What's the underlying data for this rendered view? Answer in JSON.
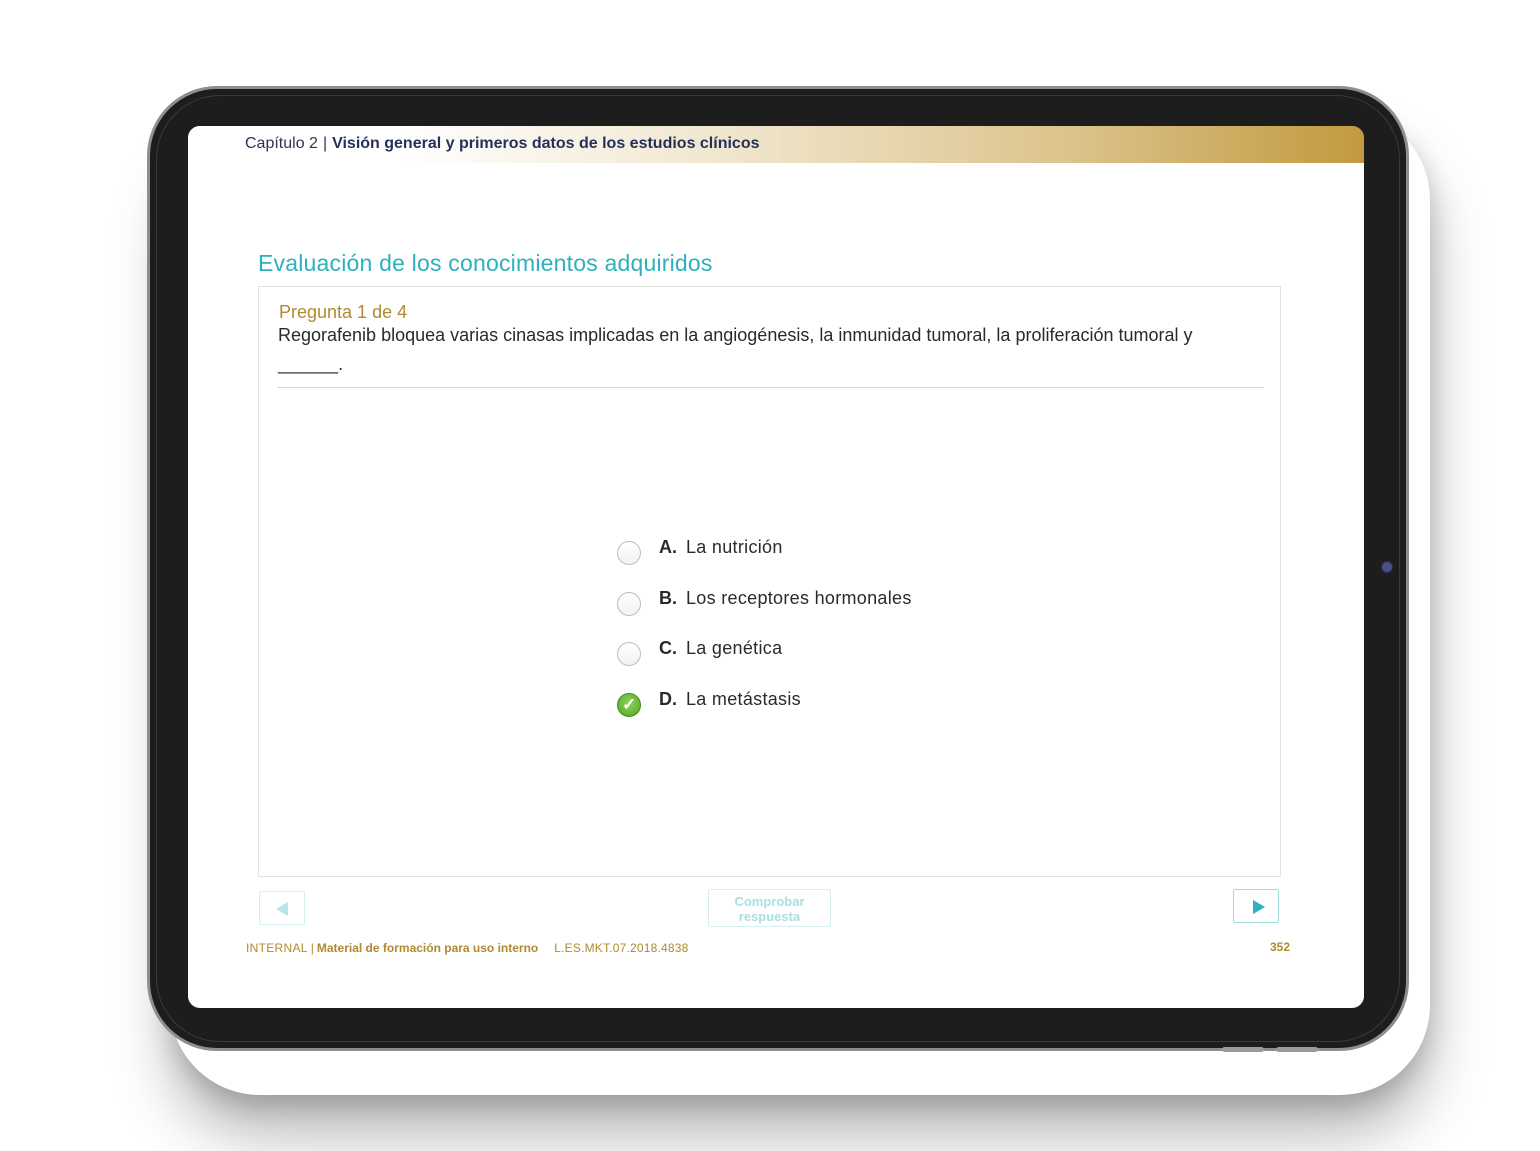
{
  "header": {
    "chapter": "Capítulo 2",
    "separator": "|",
    "title": "Visión general y primeros datos de los estudios clínicos"
  },
  "section_title": "Evaluación de los conocimientos adquiridos",
  "question": {
    "counter": "Pregunta 1 de 4",
    "text": "Regorafenib bloquea varias cinasas implicadas en la angiogénesis, la inmunidad tumoral, la proliferación tumoral y ______."
  },
  "options": [
    {
      "letter": "A.",
      "text": "La nutrición",
      "selected": false
    },
    {
      "letter": "B.",
      "text": "Los receptores hormonales",
      "selected": false
    },
    {
      "letter": "C.",
      "text": "La genética",
      "selected": false
    },
    {
      "letter": "D.",
      "text": "La metástasis",
      "selected": true,
      "icon": "checkmark-icon",
      "glyph": "✓"
    }
  ],
  "buttons": {
    "check_line1": "Comprobar",
    "check_line2": "respuesta"
  },
  "footer": {
    "internal": "INTERNAL",
    "separator": "|",
    "material": "Material de formación para uso interno",
    "code": "L.ES.MKT.07.2018.4838",
    "page": "352"
  },
  "colors": {
    "accent": "#2cb1bd",
    "gold": "#b08a2e",
    "correct": "#4da726"
  }
}
